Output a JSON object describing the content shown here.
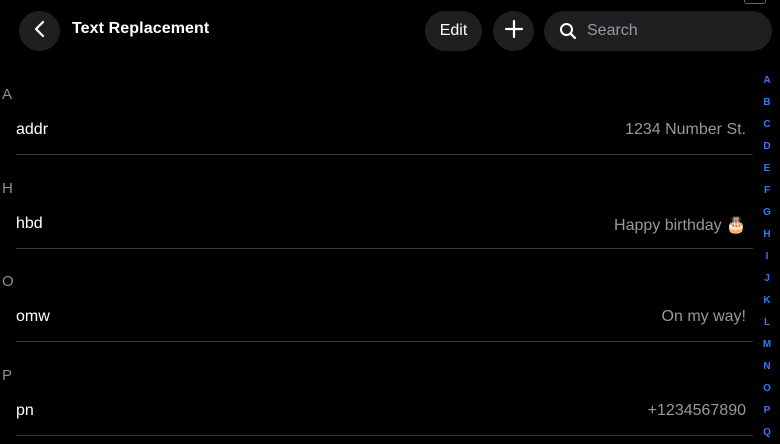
{
  "header": {
    "title": "Text Replacement",
    "edit_label": "Edit",
    "search_placeholder": "Search"
  },
  "icons": {
    "back": "chevron-left-icon",
    "add": "plus-icon",
    "search": "magnifier-icon",
    "cake": "birthday-cake-emoji"
  },
  "sections": [
    {
      "letter": "A",
      "shortcut": "addr",
      "phrase": "1234 Number St."
    },
    {
      "letter": "H",
      "shortcut": "hbd",
      "phrase": "Happy birthday 🎂"
    },
    {
      "letter": "O",
      "shortcut": "omw",
      "phrase": "On my way!"
    },
    {
      "letter": "P",
      "shortcut": "pn",
      "phrase": "+1234567890"
    }
  ],
  "index": [
    "A",
    "B",
    "C",
    "D",
    "E",
    "F",
    "G",
    "H",
    "I",
    "J",
    "K",
    "L",
    "M",
    "N",
    "O",
    "P",
    "Q"
  ],
  "colors": {
    "background": "#000000",
    "button_bg": "#1f1f21",
    "accent": "#2f7bf5",
    "secondary_text": "#98989d",
    "separator": "#38383a"
  }
}
